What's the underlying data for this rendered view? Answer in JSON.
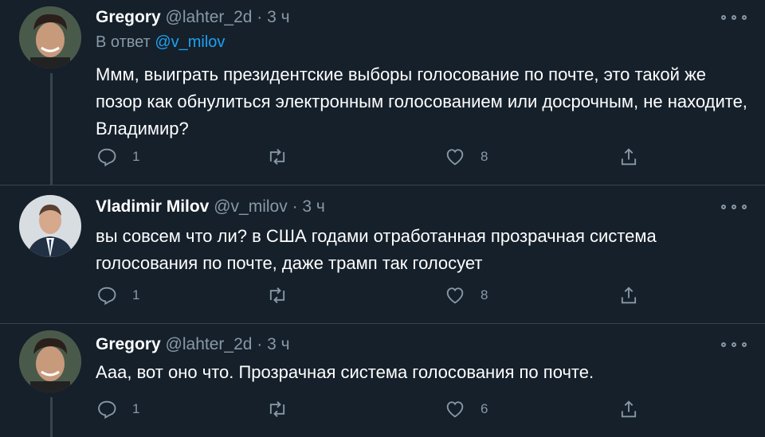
{
  "tweets": [
    {
      "name": "Gregory",
      "handle": "@lahter_2d",
      "sep": "·",
      "time": "3 ч",
      "reply_prefix": "В ответ",
      "reply_mention": "@v_milov",
      "text": "Ммм, выиграть президентские выборы голосование по почте, это такой же позор как обнулиться электронным голосованием или досрочным, не находите, Владимир?",
      "replies": "1",
      "retweets": "",
      "likes": "8"
    },
    {
      "name": "Vladimir Milov",
      "handle": "@v_milov",
      "sep": "·",
      "time": "3 ч",
      "text": "вы совсем что ли? в США годами отработанная прозрачная система голосования по почте, даже трамп так голосует",
      "replies": "1",
      "retweets": "",
      "likes": "8"
    },
    {
      "name": "Gregory",
      "handle": "@lahter_2d",
      "sep": "·",
      "time": "3 ч",
      "text": "Ааа, вот оно что. Прозрачная система голосования по почте.",
      "replies": "1",
      "retweets": "",
      "likes": "6"
    }
  ],
  "colors": {
    "background": "#15202b",
    "secondary_text": "#8899a6",
    "link": "#1da1f2",
    "divider": "#38444d"
  },
  "icons": [
    "reply-icon",
    "retweet-icon",
    "like-icon",
    "share-icon",
    "more-icon"
  ]
}
